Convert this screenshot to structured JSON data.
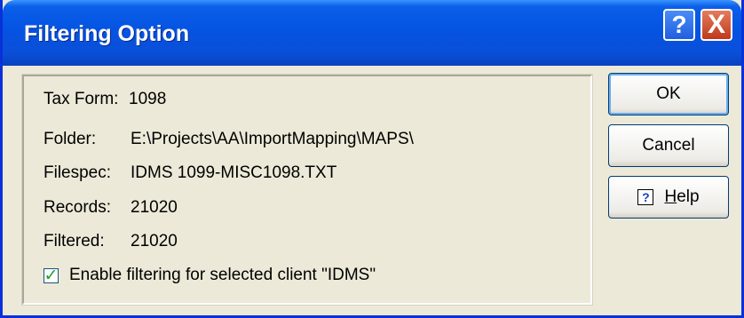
{
  "window": {
    "title": "Filtering Option"
  },
  "titlebar_buttons": {
    "help": "?",
    "close": "X"
  },
  "info": {
    "tax_form": {
      "label": "Tax Form:",
      "value": "1098"
    },
    "folder": {
      "label": "Folder:",
      "value": "E:\\Projects\\AA\\ImportMapping\\MAPS\\"
    },
    "filespec": {
      "label": "Filespec:",
      "value": "IDMS 1099-MISC1098.TXT"
    },
    "records": {
      "label": "Records:",
      "value": "21020"
    },
    "filtered": {
      "label": "Filtered:",
      "value": "21020"
    }
  },
  "checkbox": {
    "label": "Enable filtering for selected client \"IDMS\"",
    "checked": true,
    "mark": "✓"
  },
  "buttons": {
    "ok": "OK",
    "cancel": "Cancel",
    "help_prefix": "H",
    "help_rest": "elp",
    "help_icon": "?"
  },
  "icons": [
    "help-icon",
    "close-icon",
    "question-icon"
  ],
  "colors": {
    "titlebar": "#0553e2",
    "face": "#ece9d8"
  }
}
